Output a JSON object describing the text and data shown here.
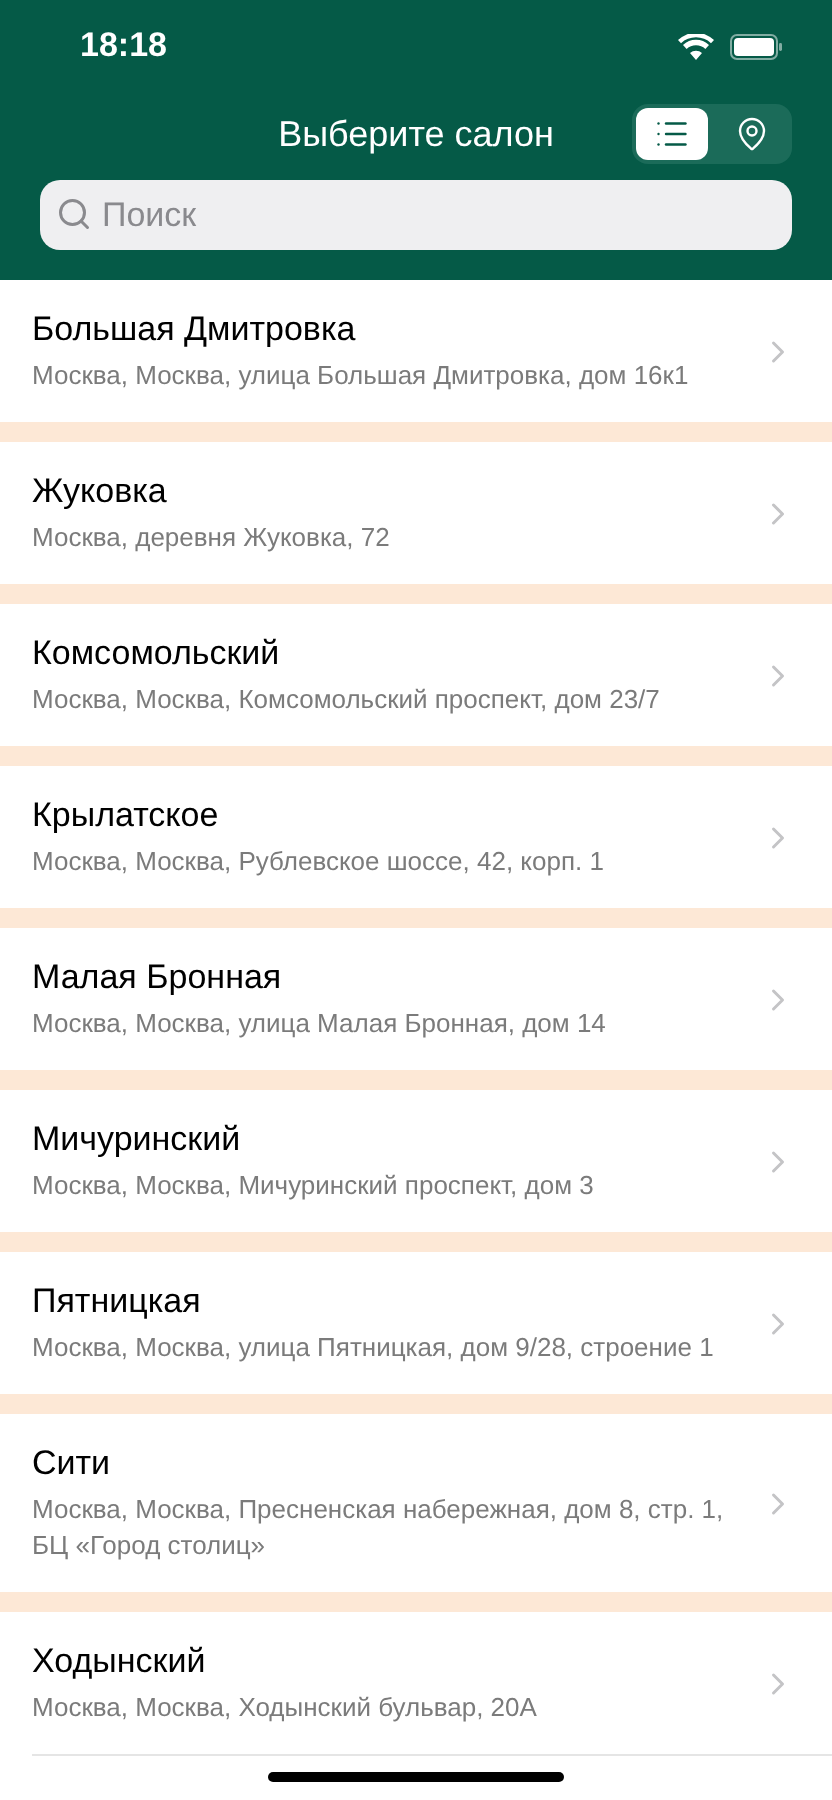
{
  "status_bar": {
    "time": "18:18"
  },
  "header": {
    "title": "Выберите салон",
    "view_toggle": [
      {
        "kind": "list",
        "selected": true
      },
      {
        "kind": "map",
        "selected": false
      }
    ]
  },
  "search": {
    "placeholder": "Поиск"
  },
  "salons": [
    {
      "name": "Большая Дмитровка",
      "address": "Москва, Москва, улица Большая Дмитровка, дом 16к1"
    },
    {
      "name": "Жуковка",
      "address": "Москва, деревня Жуковка, 72"
    },
    {
      "name": "Комсомольский",
      "address": "Москва, Москва, Комсомольский проспект, дом 23/7"
    },
    {
      "name": "Крылатское",
      "address": "Москва, Москва, Рублевское шоссе, 42, корп. 1"
    },
    {
      "name": "Малая Бронная",
      "address": "Москва, Москва, улица Малая Бронная, дом 14"
    },
    {
      "name": "Мичуринский",
      "address": "Москва, Москва, Мичуринский проспект, дом 3"
    },
    {
      "name": "Пятницкая",
      "address": "Москва, Москва, улица Пятницкая, дом 9/28, строение 1"
    },
    {
      "name": "Сити",
      "address": "Москва, Москва, Пресненская набережная, дом 8, стр. 1, БЦ «Город столиц»"
    },
    {
      "name": "Ходынский",
      "address": "Москва, Москва, Ходынский бульвар, 20А"
    }
  ]
}
